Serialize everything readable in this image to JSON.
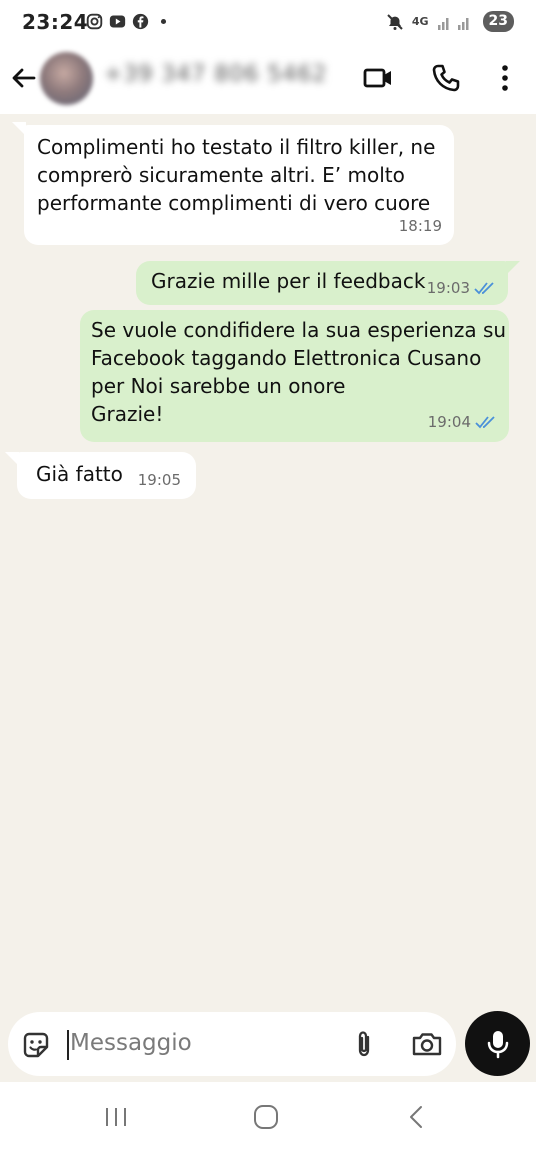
{
  "status_bar": {
    "time": "23:24",
    "network": "4G",
    "battery": "23",
    "icons": [
      "instagram-icon",
      "youtube-icon",
      "facebook-icon",
      "dot-icon",
      "mute-icon",
      "signal-icon"
    ]
  },
  "header": {
    "contact": "+39 347 806 5462",
    "icons": [
      "back-arrow-icon",
      "video-call-icon",
      "phone-icon",
      "more-vert-icon"
    ]
  },
  "messages": [
    {
      "direction": "in",
      "text": "Complimenti ho testato il filtro killer, ne\ncomprerò sicuramente altri. E’ molto\nperformante complimenti di vero cuore",
      "time": "18:19"
    },
    {
      "direction": "out",
      "text": "Grazie mille per il feedback",
      "time": "19:03",
      "read": true
    },
    {
      "direction": "out",
      "text": "Se vuole condifidere la sua esperienza su\nFacebook taggando Elettronica Cusano\nper Noi sarebbe un onore\nGrazie!",
      "time": "19:04",
      "read": true
    },
    {
      "direction": "in",
      "text": "Già fatto",
      "time": "19:05"
    }
  ],
  "composer": {
    "placeholder": "Messaggio",
    "icons": [
      "sticker-icon",
      "attach-icon",
      "camera-icon",
      "mic-icon"
    ]
  },
  "navbar": {
    "icons": [
      "recents-icon",
      "home-icon",
      "back-icon"
    ]
  },
  "colors": {
    "chat_bg": "#f4f1ea",
    "incoming": "#ffffff",
    "outgoing": "#d9f0cc",
    "read_ticks": "#4a90d9"
  }
}
